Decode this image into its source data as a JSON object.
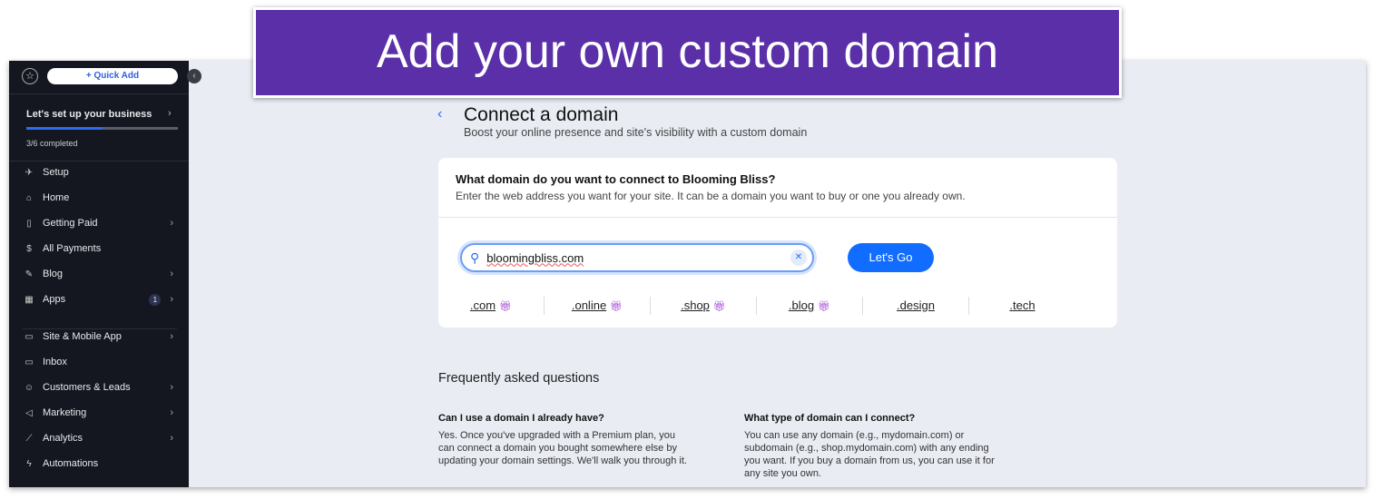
{
  "banner": {
    "text": "Add your own custom domain"
  },
  "sidebar": {
    "quick_add": "+ Quick Add",
    "setup_title": "Let's set up your business",
    "progress_fraction": 0.5,
    "completed": "3/6 completed",
    "items": [
      {
        "label": "Setup",
        "icon": "rocket-icon",
        "chevron": false
      },
      {
        "label": "Home",
        "icon": "home-icon",
        "chevron": false
      },
      {
        "label": "Getting Paid",
        "icon": "invoice-icon",
        "chevron": true
      },
      {
        "label": "All Payments",
        "icon": "dollar-icon",
        "chevron": false
      },
      {
        "label": "Blog",
        "icon": "pen-icon",
        "chevron": true
      },
      {
        "label": "Apps",
        "icon": "apps-icon",
        "chevron": true,
        "badge": "1"
      },
      {
        "label": "Site & Mobile App",
        "icon": "devices-icon",
        "chevron": true
      },
      {
        "label": "Inbox",
        "icon": "inbox-icon",
        "chevron": false
      },
      {
        "label": "Customers & Leads",
        "icon": "people-icon",
        "chevron": true
      },
      {
        "label": "Marketing",
        "icon": "megaphone-icon",
        "chevron": true
      },
      {
        "label": "Analytics",
        "icon": "chart-icon",
        "chevron": true
      },
      {
        "label": "Automations",
        "icon": "bolt-icon",
        "chevron": false
      }
    ]
  },
  "main": {
    "title": "Connect a domain",
    "subtitle": "Boost your online presence and site's visibility with a custom domain",
    "card": {
      "question": "What domain do you want to connect to Blooming Bliss?",
      "description": "Enter the web address you want for your site. It can be a domain you want to buy or one you already own.",
      "search_value": "bloomingbliss.com",
      "go_label": "Let's Go",
      "tlds": [
        {
          "label": ".com",
          "gift": true
        },
        {
          "label": ".online",
          "gift": true
        },
        {
          "label": ".shop",
          "gift": true
        },
        {
          "label": ".blog",
          "gift": true
        },
        {
          "label": ".design",
          "gift": false
        },
        {
          "label": ".tech",
          "gift": false
        }
      ]
    },
    "faq": {
      "heading": "Frequently asked questions",
      "items": [
        {
          "q": "Can I use a domain I already have?",
          "a": "Yes. Once you've upgraded with a Premium plan, you can connect a domain you bought somewhere else by updating your domain settings. We'll walk you through it."
        },
        {
          "q": "What type of domain can I connect?",
          "a": "You can use any domain (e.g., mydomain.com) or subdomain (e.g., shop.mydomain.com) with any ending you want. If you buy a domain from us, you can use it for any site you own."
        }
      ]
    }
  }
}
